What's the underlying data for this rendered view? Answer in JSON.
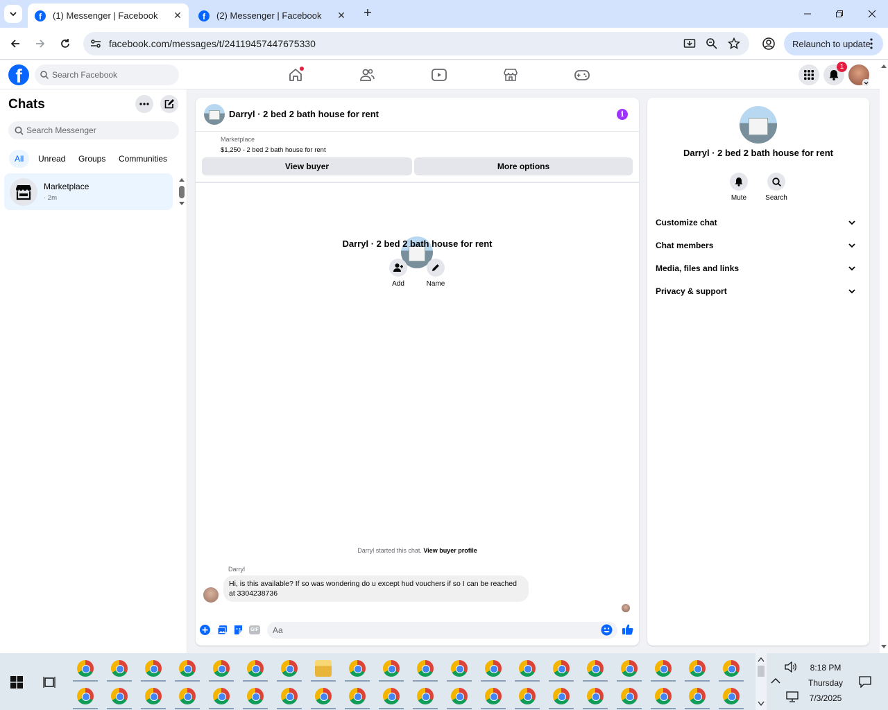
{
  "browser": {
    "tabs": [
      {
        "title": "(1) Messenger | Facebook",
        "active": true
      },
      {
        "title": "(2) Messenger | Facebook",
        "active": false
      }
    ],
    "new_tab_glyph": "+",
    "close_glyph": "✕",
    "url": "facebook.com/messages/t/24119457447675330",
    "relaunch_label": "Relaunch to update"
  },
  "fb_header": {
    "logo_letter": "f",
    "search_placeholder": "Search Facebook",
    "notification_count": "1",
    "nav_icons": [
      "home-icon",
      "friends-icon",
      "video-icon",
      "marketplace-icon",
      "gaming-icon"
    ]
  },
  "left": {
    "title": "Chats",
    "search_placeholder": "Search Messenger",
    "filters": [
      "All",
      "Unread",
      "Groups",
      "Communities"
    ],
    "selected_filter": "All",
    "chat": {
      "name": "Marketplace",
      "time": "· 2m"
    }
  },
  "conversation": {
    "title": "Darryl · 2 bed 2 bath house for rent",
    "listing_label": "Marketplace",
    "listing_title": "$1,250 - 2 bed 2 bath house for rent",
    "view_buyer": "View buyer",
    "more_options": "More options",
    "intro_name": "Darryl · 2 bed 2 bath house for rent",
    "add_label": "Add",
    "name_label": "Name",
    "started_text": "Darryl started this chat.",
    "view_buyer_profile": "View buyer profile",
    "sender": "Darryl",
    "message": "Hi, is this available? If so was wondering do u except hud vouchers if so I can be reached at 3304238736",
    "composer_placeholder": "Aa",
    "gif_label": "GIF"
  },
  "details": {
    "name": "Darryl · 2 bed 2 bath house for rent",
    "mute_label": "Mute",
    "search_label": "Search",
    "sections": [
      "Customize chat",
      "Chat members",
      "Media, files and links",
      "Privacy & support"
    ]
  },
  "taskbar": {
    "time": "8:18 PM",
    "day": "Thursday",
    "date": "7/3/2025"
  },
  "colors": {
    "facebook_blue": "#0866ff",
    "info_purple": "#a033ff",
    "badge_red": "#e41e3f"
  }
}
